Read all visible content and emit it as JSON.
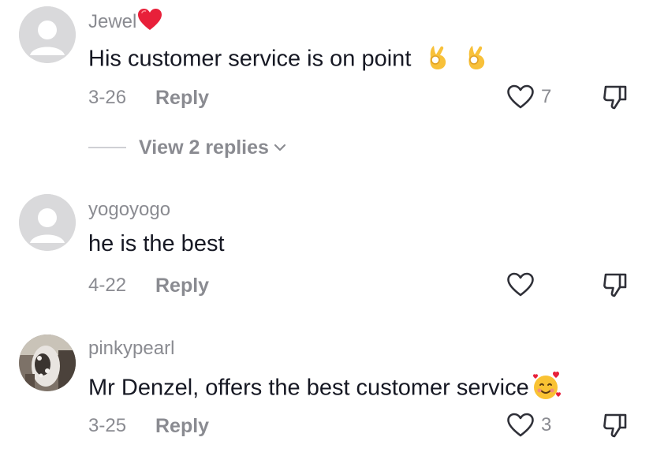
{
  "comments": [
    {
      "username": "Jewel",
      "username_emoji": "red-heart-emoji",
      "text": "His customer service is on point",
      "text_emoji": "ok-hand-emoji",
      "date": "3-26",
      "reply_label": "Reply",
      "like_count": "7"
    },
    {
      "username": "yogoyogo",
      "text": "he is the best",
      "date": "4-22",
      "reply_label": "Reply",
      "like_count": ""
    },
    {
      "username": "pinkypearl",
      "text": "Mr Denzel, offers the best customer service",
      "text_emoji": "smiling-face-with-hearts-emoji",
      "date": "3-25",
      "reply_label": "Reply",
      "like_count": "3"
    }
  ],
  "view_replies": {
    "label": "View 2 replies"
  },
  "colors": {
    "text": "#161823",
    "muted": "#8a8b91",
    "avatar_placeholder": "#d8d8d8",
    "heart": "#e8203a"
  },
  "icons": [
    "heart-outline-icon",
    "thumbs-down-icon",
    "chevron-down-icon",
    "default-avatar-icon"
  ]
}
